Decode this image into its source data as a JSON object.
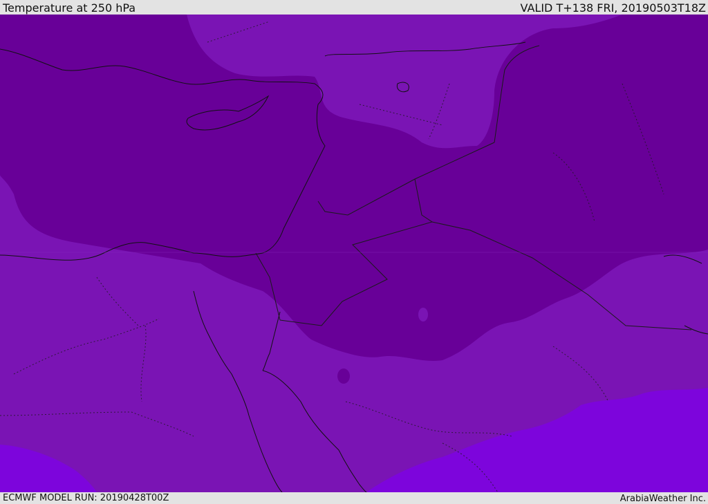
{
  "header": {
    "title": "Temperature at 250 hPa",
    "valid": "VALID T+138 FRI, 20190503T18Z"
  },
  "footer": {
    "model_run": "ECMWF MODEL RUN: 20190428T00Z",
    "credit": "ArabiaWeather Inc."
  },
  "map": {
    "colors": {
      "cold": "#680098",
      "mid": "#7a14b4",
      "warm": "#7d05dc",
      "coast": "#111111",
      "border": "#1a1a1a"
    }
  }
}
